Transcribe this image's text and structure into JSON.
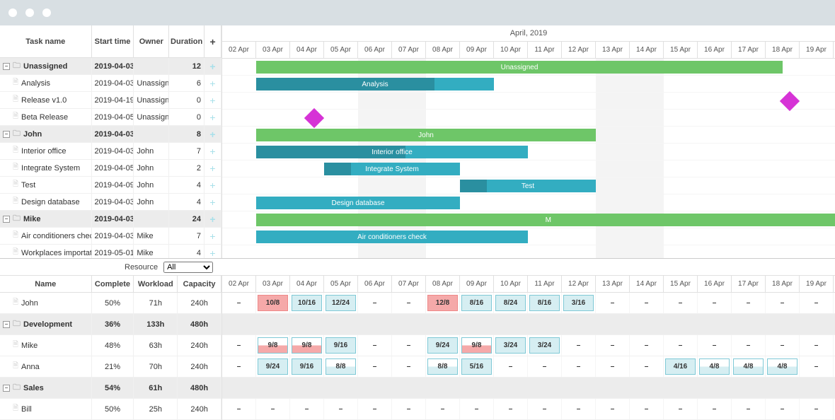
{
  "chrome": {},
  "gantt": {
    "headers": {
      "name": "Task name",
      "start": "Start time",
      "owner": "Owner",
      "duration": "Duration"
    },
    "month_label": "April, 2019",
    "days": [
      "02 Apr",
      "03 Apr",
      "04 Apr",
      "05 Apr",
      "06 Apr",
      "07 Apr",
      "08 Apr",
      "09 Apr",
      "10 Apr",
      "11 Apr",
      "12 Apr",
      "13 Apr",
      "14 Apr",
      "15 Apr",
      "16 Apr",
      "17 Apr",
      "18 Apr",
      "19 Apr"
    ],
    "rows": [
      {
        "type": "group",
        "name": "Unassigned",
        "start": "2019-04-03",
        "owner": "",
        "duration": "12",
        "bar": {
          "color": "green",
          "label": "Unassigned",
          "from": 1,
          "span": 15.5
        }
      },
      {
        "type": "task",
        "name": "Analysis",
        "start": "2019-04-03",
        "owner": "Unassigned",
        "duration": "6",
        "bar": {
          "color": "teal",
          "label": "Analysis",
          "from": 1,
          "span": 7,
          "progress": 0.75
        }
      },
      {
        "type": "task",
        "name": "Release v1.0",
        "start": "2019-04-19",
        "owner": "Unassigned",
        "duration": "0",
        "milestone": {
          "at": 16.7
        }
      },
      {
        "type": "task",
        "name": "Beta Release",
        "start": "2019-04-05",
        "owner": "Unassigned",
        "duration": "0",
        "milestone": {
          "at": 2.7
        }
      },
      {
        "type": "group",
        "name": "John",
        "start": "2019-04-03",
        "owner": "",
        "duration": "8",
        "bar": {
          "color": "green",
          "label": "John",
          "from": 1,
          "span": 10
        }
      },
      {
        "type": "task",
        "name": "Interior office",
        "start": "2019-04-03",
        "owner": "John",
        "duration": "7",
        "bar": {
          "color": "teal",
          "label": "Interior office",
          "from": 1,
          "span": 8,
          "progress": 0.55
        }
      },
      {
        "type": "task",
        "name": "Integrate System",
        "start": "2019-04-05",
        "owner": "John",
        "duration": "2",
        "bar": {
          "color": "teal",
          "label": "Integrate System",
          "from": 3,
          "span": 4,
          "progress": 0.2
        }
      },
      {
        "type": "task",
        "name": "Test",
        "start": "2019-04-09",
        "owner": "John",
        "duration": "4",
        "bar": {
          "color": "teal",
          "label": "Test",
          "from": 7,
          "span": 4,
          "progress": 0.2
        }
      },
      {
        "type": "task",
        "name": "Design database",
        "start": "2019-04-03",
        "owner": "John",
        "duration": "4",
        "bar": {
          "color": "teal",
          "label": "Design database",
          "from": 1,
          "span": 6,
          "progress": 0
        }
      },
      {
        "type": "group",
        "name": "Mike",
        "start": "2019-04-03",
        "owner": "",
        "duration": "24",
        "bar": {
          "color": "green",
          "label": "M",
          "from": 1,
          "span": 17.2
        }
      },
      {
        "type": "task",
        "name": "Air conditioners check",
        "start": "2019-04-03",
        "owner": "Mike",
        "duration": "7",
        "bar": {
          "color": "teal",
          "label": "Air conditioners check",
          "from": 1,
          "span": 8,
          "progress": 0
        }
      },
      {
        "type": "task",
        "name": "Workplaces importation",
        "start": "2019-05-01",
        "owner": "Mike",
        "duration": "4"
      }
    ]
  },
  "resource": {
    "filter_label": "Resource",
    "filter_value": "All",
    "headers": {
      "name": "Name",
      "complete": "Complete",
      "workload": "Workload",
      "capacity": "Capacity"
    },
    "days": [
      "02 Apr",
      "03 Apr",
      "04 Apr",
      "05 Apr",
      "06 Apr",
      "07 Apr",
      "08 Apr",
      "09 Apr",
      "10 Apr",
      "11 Apr",
      "12 Apr",
      "13 Apr",
      "14 Apr",
      "15 Apr",
      "16 Apr",
      "17 Apr",
      "18 Apr",
      "19 Apr"
    ],
    "rows": [
      {
        "type": "person",
        "name": "John",
        "complete": "50%",
        "workload": "71h",
        "capacity": "240h",
        "cells": [
          {
            "v": "–"
          },
          {
            "v": "10/8",
            "c": "red"
          },
          {
            "v": "10/16",
            "c": "blue"
          },
          {
            "v": "12/24",
            "c": "blue"
          },
          {
            "v": "–"
          },
          {
            "v": "–"
          },
          {
            "v": "12/8",
            "c": "red"
          },
          {
            "v": "8/16",
            "c": "blue"
          },
          {
            "v": "8/24",
            "c": "blue"
          },
          {
            "v": "8/16",
            "c": "blue"
          },
          {
            "v": "3/16",
            "c": "blue"
          },
          {
            "v": "–"
          },
          {
            "v": "–"
          },
          {
            "v": "–"
          },
          {
            "v": "–"
          },
          {
            "v": "–"
          },
          {
            "v": "–"
          },
          {
            "v": "–"
          }
        ]
      },
      {
        "type": "group",
        "name": "Development",
        "complete": "36%",
        "workload": "133h",
        "capacity": "480h"
      },
      {
        "type": "person",
        "name": "Mike",
        "complete": "48%",
        "workload": "63h",
        "capacity": "240h",
        "cells": [
          {
            "v": "–"
          },
          {
            "v": "9/8",
            "c": "half"
          },
          {
            "v": "9/8",
            "c": "half"
          },
          {
            "v": "9/16",
            "c": "blue"
          },
          {
            "v": "–"
          },
          {
            "v": "–"
          },
          {
            "v": "9/24",
            "c": "blue"
          },
          {
            "v": "9/8",
            "c": "half"
          },
          {
            "v": "3/24",
            "c": "blue"
          },
          {
            "v": "3/24",
            "c": "blue"
          },
          {
            "v": "–"
          },
          {
            "v": "–"
          },
          {
            "v": "–"
          },
          {
            "v": "–"
          },
          {
            "v": "–"
          },
          {
            "v": "–"
          },
          {
            "v": "–"
          },
          {
            "v": "–"
          }
        ]
      },
      {
        "type": "person",
        "name": "Anna",
        "complete": "21%",
        "workload": "70h",
        "capacity": "240h",
        "cells": [
          {
            "v": "–"
          },
          {
            "v": "9/24",
            "c": "blue"
          },
          {
            "v": "9/16",
            "c": "blue"
          },
          {
            "v": "8/8",
            "c": "halfblue"
          },
          {
            "v": "–"
          },
          {
            "v": "–"
          },
          {
            "v": "8/8",
            "c": "halfblue"
          },
          {
            "v": "5/16",
            "c": "blue"
          },
          {
            "v": "–"
          },
          {
            "v": "–"
          },
          {
            "v": "–"
          },
          {
            "v": "–"
          },
          {
            "v": "–"
          },
          {
            "v": "4/16",
            "c": "blue"
          },
          {
            "v": "4/8",
            "c": "halfblue"
          },
          {
            "v": "4/8",
            "c": "halfblue"
          },
          {
            "v": "4/8",
            "c": "halfblue"
          },
          {
            "v": "–"
          }
        ]
      },
      {
        "type": "group",
        "name": "Sales",
        "complete": "54%",
        "workload": "61h",
        "capacity": "480h"
      },
      {
        "type": "person",
        "name": "Bill",
        "complete": "50%",
        "workload": "25h",
        "capacity": "240h",
        "cells": [
          {
            "v": "–"
          },
          {
            "v": "–"
          },
          {
            "v": "–"
          },
          {
            "v": "–"
          },
          {
            "v": "–"
          },
          {
            "v": "–"
          },
          {
            "v": "–"
          },
          {
            "v": "–"
          },
          {
            "v": "–"
          },
          {
            "v": "–"
          },
          {
            "v": "–"
          },
          {
            "v": "–"
          },
          {
            "v": "–"
          },
          {
            "v": "–"
          },
          {
            "v": "–"
          },
          {
            "v": "–"
          },
          {
            "v": "–"
          },
          {
            "v": "–"
          }
        ]
      }
    ]
  }
}
